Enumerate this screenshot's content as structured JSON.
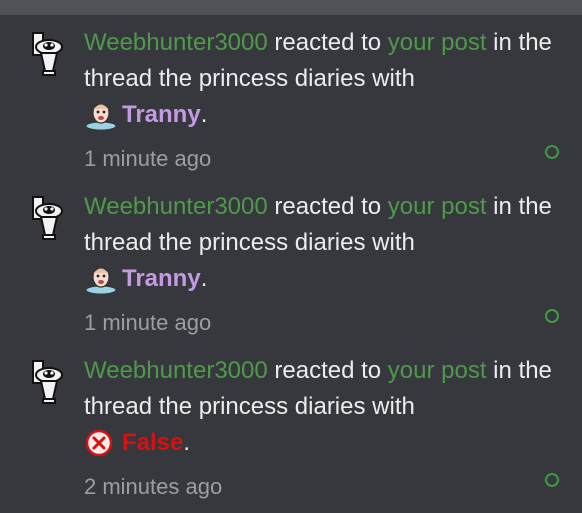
{
  "alerts": [
    {
      "user": "Weebhunter3000",
      "action": "reacted to",
      "post_link": "your post",
      "middle": "in the thread the princess diaries with",
      "reaction": "Tranny",
      "reaction_icon": "tranny-face-icon",
      "end_punct": ".",
      "time": "1 minute ago"
    },
    {
      "user": "Weebhunter3000",
      "action": "reacted to",
      "post_link": "your post",
      "middle": "in the thread the princess diaries with",
      "reaction": "Tranny",
      "reaction_icon": "tranny-face-icon",
      "end_punct": ".",
      "time": "1 minute ago"
    },
    {
      "user": "Weebhunter3000",
      "action": "reacted to",
      "post_link": "your post",
      "middle": "in the thread the princess diaries with",
      "reaction": "False",
      "reaction_icon": "false-x-icon",
      "end_punct": ".",
      "time": "2 minutes ago"
    }
  ],
  "colors": {
    "background": "#36383d",
    "user_link": "#4f9a4a",
    "reaction_tranny": "#c49ae3",
    "reaction_false": "#d41212",
    "timestamp": "#9b9ea5",
    "unread_dot": "#3f9b3f"
  }
}
